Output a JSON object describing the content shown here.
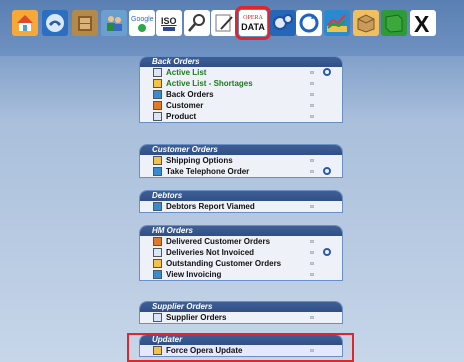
{
  "toolbar": {
    "buttons": [
      {
        "name": "home-icon"
      },
      {
        "name": "telephone-icon"
      },
      {
        "name": "filing-cabinet-icon"
      },
      {
        "name": "users-icon"
      },
      {
        "name": "google-maps-icon"
      },
      {
        "name": "iso-icon",
        "label": "ISO"
      },
      {
        "name": "search-icon"
      },
      {
        "name": "edit-note-icon"
      },
      {
        "name": "opera-data-icon",
        "label_top": "OPERA",
        "label_bottom": "DATA",
        "selected": true
      },
      {
        "name": "gears-icon"
      },
      {
        "name": "refresh-icon"
      },
      {
        "name": "chart-icon"
      },
      {
        "name": "package-box-icon"
      },
      {
        "name": "green-book-icon"
      },
      {
        "name": "close-icon",
        "label": "X"
      }
    ]
  },
  "panels": [
    {
      "title": "Back Orders",
      "items": [
        {
          "label": "Active List",
          "color": "green",
          "refresh": true
        },
        {
          "label": "Active List - Shortages",
          "color": "green",
          "refresh": false
        },
        {
          "label": "Back Orders",
          "color": "black",
          "refresh": false
        },
        {
          "label": "Customer",
          "color": "black",
          "refresh": false
        },
        {
          "label": "Product",
          "color": "black",
          "refresh": false
        }
      ]
    },
    {
      "title": "Customer Orders",
      "items": [
        {
          "label": "Shipping Options",
          "color": "black",
          "refresh": false
        },
        {
          "label": "Take Telephone Order",
          "color": "black",
          "refresh": true
        }
      ]
    },
    {
      "title": "Debtors",
      "items": [
        {
          "label": "Debtors Report Viamed",
          "color": "black",
          "refresh": false
        }
      ]
    },
    {
      "title": "HM Orders",
      "items": [
        {
          "label": "Delivered Customer Orders",
          "color": "black",
          "refresh": false
        },
        {
          "label": "Deliveries Not Invoiced",
          "color": "black",
          "refresh": true
        },
        {
          "label": "Outstanding Customer Orders",
          "color": "black",
          "refresh": false
        },
        {
          "label": "View Invoicing",
          "color": "black",
          "refresh": false
        }
      ]
    },
    {
      "title": "Supplier Orders",
      "items": [
        {
          "label": "Supplier Orders",
          "color": "black",
          "refresh": false
        }
      ]
    },
    {
      "title": "Updater",
      "items": [
        {
          "label": "Force Opera Update",
          "color": "black",
          "refresh": false,
          "highlight": true
        }
      ]
    }
  ]
}
